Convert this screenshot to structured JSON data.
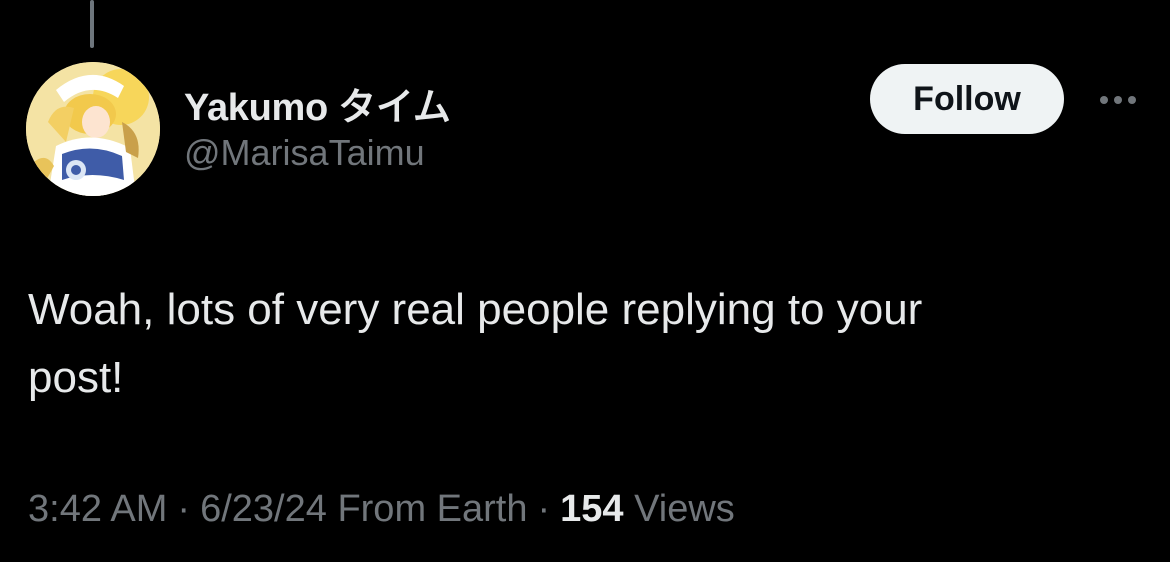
{
  "post": {
    "author": {
      "display_name": "Yakumo タイム",
      "handle": "@MarisaTaimu",
      "avatar_icon": "anime-character-avatar-icon"
    },
    "follow_label": "Follow",
    "more_icon": "more-options-icon",
    "text": "Woah, lots of very real people replying to your\npost!",
    "meta": {
      "time": "3:42 AM",
      "date": "6/23/24",
      "source": "From Earth",
      "views_count": "154",
      "views_label": "Views",
      "separator": "·"
    }
  },
  "colors": {
    "background": "#000000",
    "primary_text": "#e7e9ea",
    "secondary_text": "#71767b",
    "follow_bg": "#eff3f4",
    "follow_text": "#0f1419"
  }
}
